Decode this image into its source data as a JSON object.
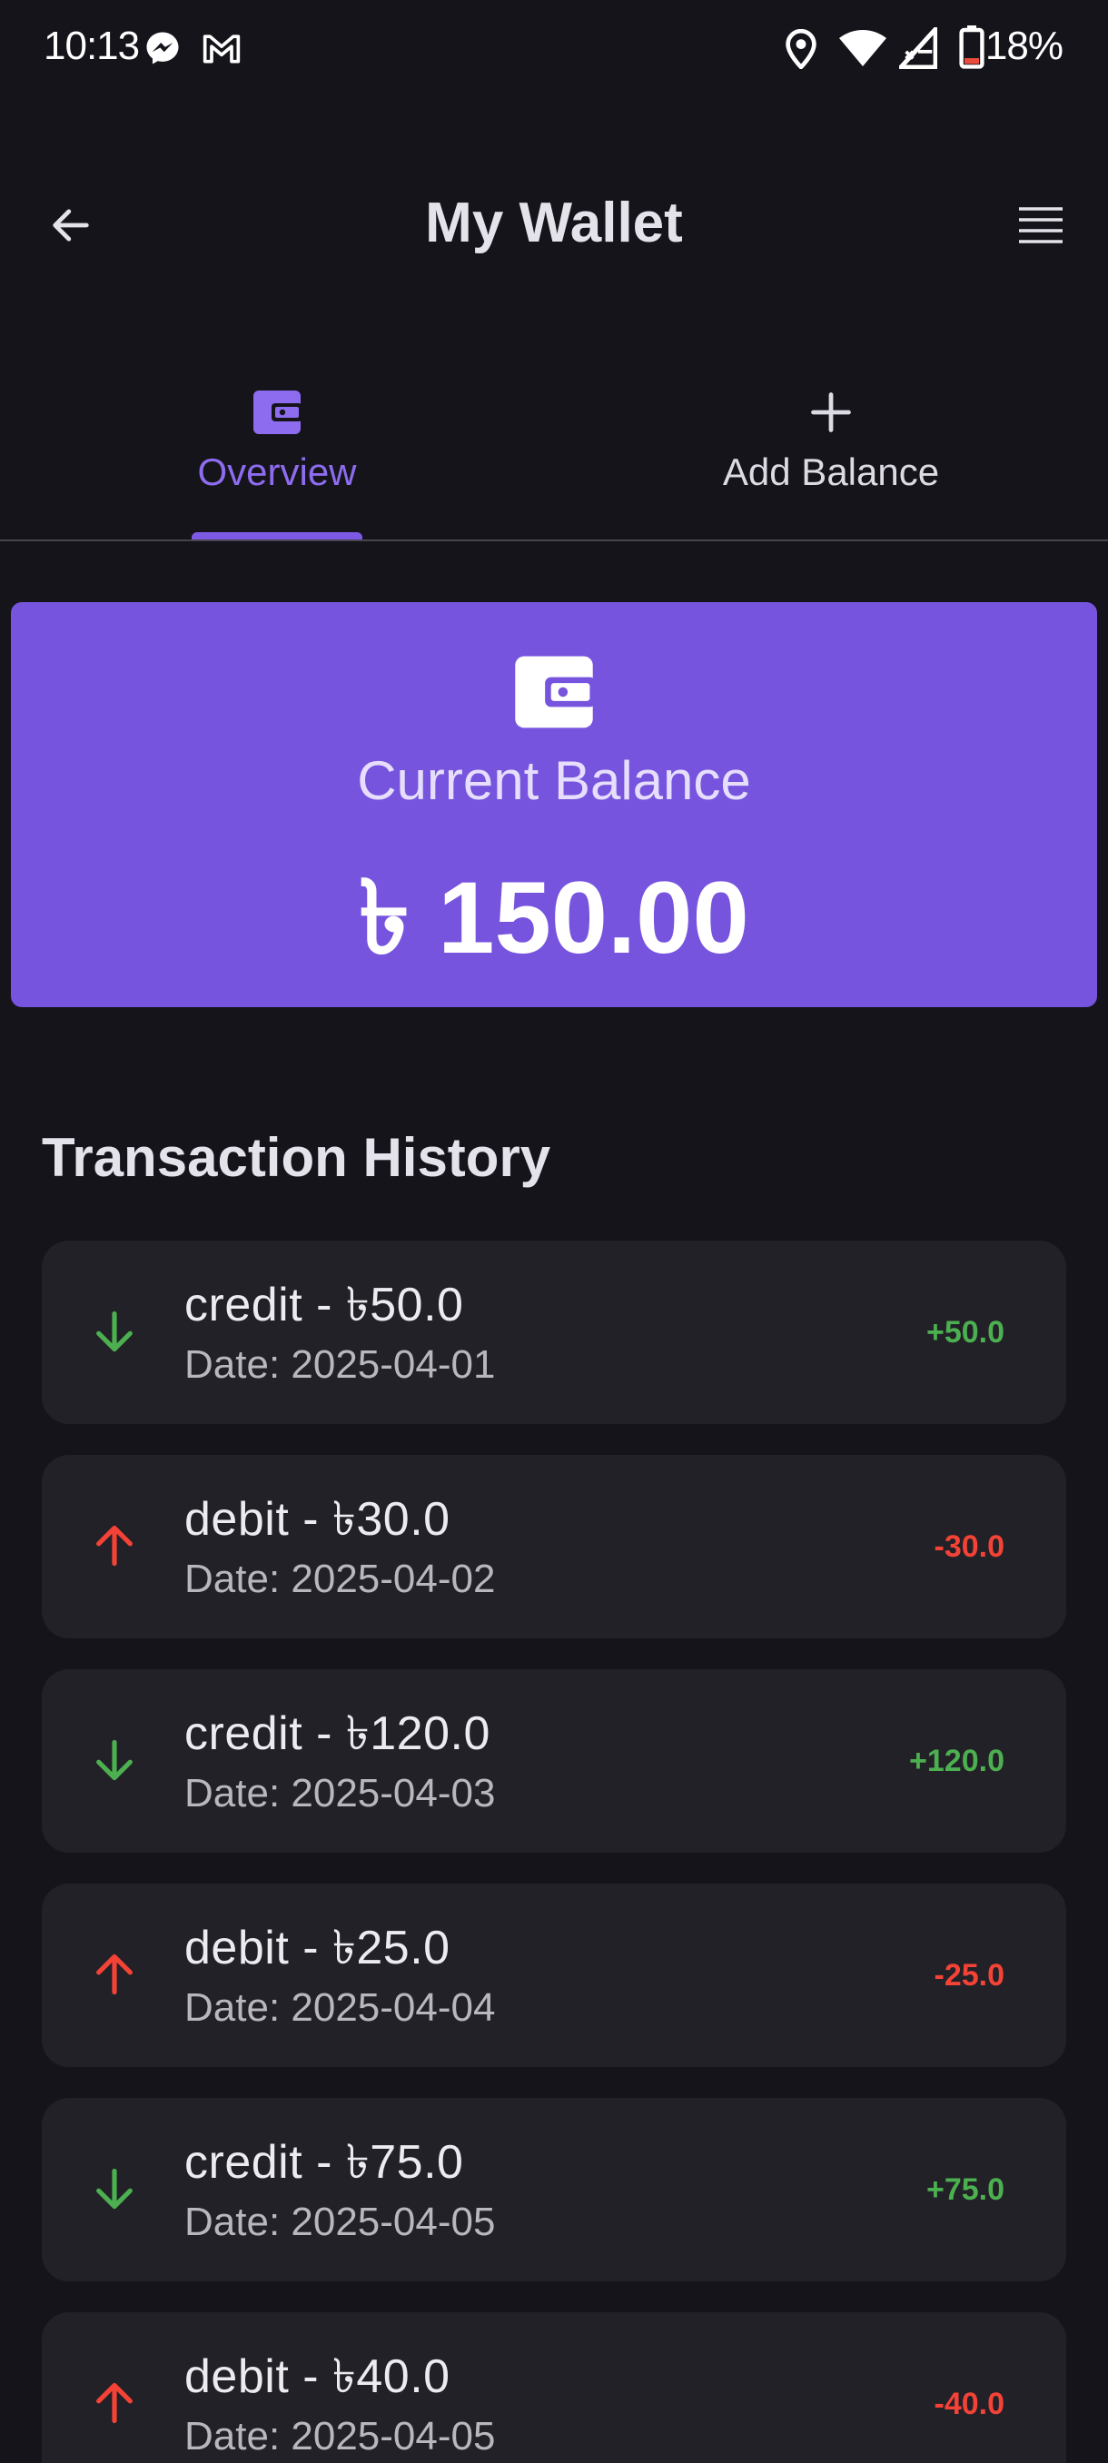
{
  "status_bar": {
    "time": "10:13",
    "battery": "18%",
    "icons": [
      "messenger-icon",
      "gmail-icon",
      "location-icon",
      "wifi-icon",
      "signal-icon",
      "battery-icon"
    ]
  },
  "app_bar": {
    "title": "My Wallet",
    "back_icon": "arrow-left-icon",
    "menu_icon": "menu-icon"
  },
  "tabs": [
    {
      "label": "Overview",
      "icon": "wallet-icon",
      "selected": true
    },
    {
      "label": "Add Balance",
      "icon": "plus-icon",
      "selected": false
    }
  ],
  "balance_card": {
    "label": "Current Balance",
    "amount": "৳ 150.00",
    "icon": "wallet-icon"
  },
  "transactions": {
    "title": "Transaction History",
    "items": [
      {
        "title": "credit - ৳50.0",
        "date": "Date: 2025-04-01",
        "amount": "+50.0",
        "type": "credit",
        "icon": "arrow-down-icon"
      },
      {
        "title": "debit - ৳30.0",
        "date": "Date: 2025-04-02",
        "amount": "-30.0",
        "type": "debit",
        "icon": "arrow-up-icon"
      },
      {
        "title": "credit - ৳120.0",
        "date": "Date: 2025-04-03",
        "amount": "+120.0",
        "type": "credit",
        "icon": "arrow-down-icon"
      },
      {
        "title": "debit - ৳25.0",
        "date": "Date: 2025-04-04",
        "amount": "-25.0",
        "type": "debit",
        "icon": "arrow-up-icon"
      },
      {
        "title": "credit - ৳75.0",
        "date": "Date: 2025-04-05",
        "amount": "+75.0",
        "type": "credit",
        "icon": "arrow-down-icon"
      },
      {
        "title": "debit - ৳40.0",
        "date": "Date: 2025-04-05",
        "amount": "-40.0",
        "type": "debit",
        "icon": "arrow-up-icon"
      }
    ]
  },
  "colors": {
    "background": "#15141b",
    "accent": "#7654de",
    "credit": "#4caf50",
    "debit": "#f44336",
    "card": "#222127"
  }
}
